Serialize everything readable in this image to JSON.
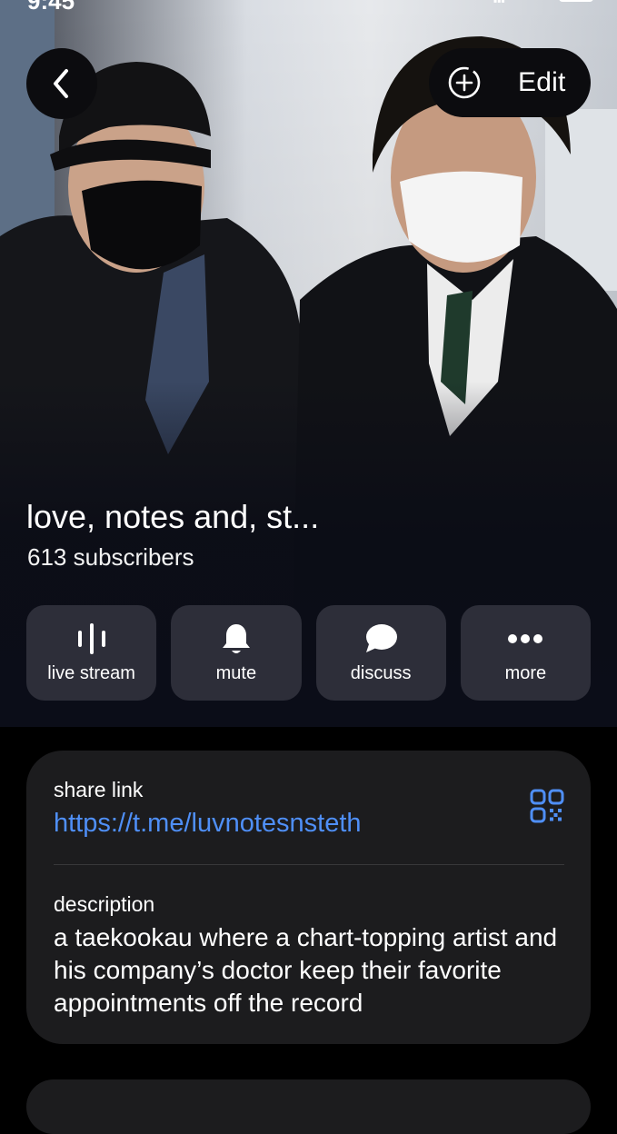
{
  "status_bar": {
    "time": "9:45"
  },
  "header": {
    "back_icon": "chevron-left-icon",
    "add_icon": "circle-plus-icon",
    "edit_label": "Edit"
  },
  "channel": {
    "title": "love, notes and, st...",
    "subscribers": "613 subscribers"
  },
  "actions": [
    {
      "label": "live stream",
      "icon": "live-stream-icon"
    },
    {
      "label": "mute",
      "icon": "bell-icon"
    },
    {
      "label": "discuss",
      "icon": "chat-bubble-icon"
    },
    {
      "label": "more",
      "icon": "ellipsis-icon"
    }
  ],
  "info": {
    "share_label": "share link",
    "share_url": "https://t.me/luvnotesnsteth",
    "qr_icon": "qr-code-icon",
    "description_label": "description",
    "description": "a taekookau where a chart-topping artist and his company’s doctor keep their favorite appointments off the record"
  },
  "colors": {
    "link": "#4f8ff7",
    "card_bg": "#1c1c1e",
    "button_bg": "#0c0c0f"
  }
}
